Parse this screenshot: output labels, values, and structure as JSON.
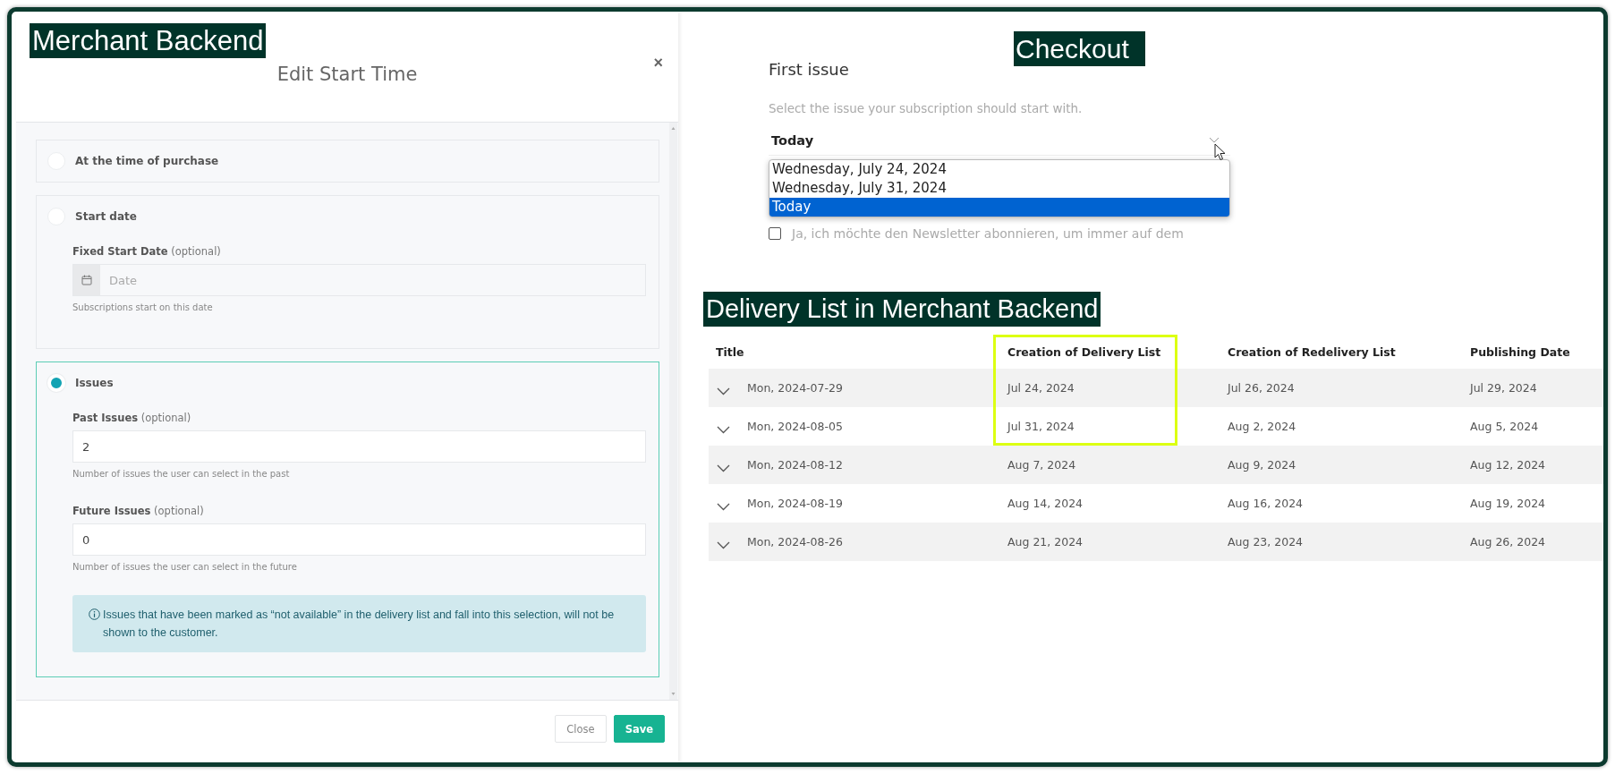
{
  "merchant_backend": {
    "banner": "Merchant Backend",
    "dialog": {
      "title": "Edit Start Time",
      "close": "×",
      "options": [
        {
          "label": "At the time of purchase",
          "selected": false
        },
        {
          "label": "Start date",
          "selected": false,
          "fields": [
            {
              "kind": "date",
              "label": "Fixed Start Date",
              "optional": "(optional)",
              "placeholder": "Date",
              "help": "Subscriptions start on this date"
            }
          ]
        },
        {
          "label": "Issues",
          "selected": true,
          "fields": [
            {
              "kind": "number",
              "label": "Past Issues",
              "optional": "(optional)",
              "value": "2",
              "help": "Number of issues the user can select in the past"
            },
            {
              "kind": "number",
              "label": "Future Issues",
              "optional": "(optional)",
              "value": "0",
              "help": "Number of issues the user can select in the future"
            }
          ],
          "notice": "Issues that have been marked as “not available” in the delivery list and fall into this selection, will not be shown to the customer."
        }
      ],
      "buttons": [
        {
          "label": "Close",
          "kind": "secondary"
        },
        {
          "label": "Save",
          "kind": "primary"
        }
      ]
    }
  },
  "checkout": {
    "banner": "Checkout",
    "heading": "First issue",
    "hint": "Select the issue your subscription should start with.",
    "select": {
      "value": "Today",
      "expanded": true,
      "options": [
        {
          "label": "Wednesday, July 24, 2024",
          "selected": false
        },
        {
          "label": "Wednesday, July 31, 2024",
          "selected": false
        },
        {
          "label": "Today",
          "selected": true
        }
      ]
    },
    "newsletter": {
      "text": "Ja, ich möchte den Newsletter abonnieren, um immer auf dem",
      "checked": false
    }
  },
  "delivery_list": {
    "banner": "Delivery List in Merchant Backend",
    "columns": [
      {
        "label": "Title",
        "highlighted": false
      },
      {
        "label": "Creation of Delivery List",
        "highlighted": true
      },
      {
        "label": "Creation of Redelivery List",
        "highlighted": false
      },
      {
        "label": "Publishing Date",
        "highlighted": false
      }
    ],
    "rows": [
      {
        "expanded": false,
        "highlighted": true,
        "cells": [
          "Mon, 2024-07-29",
          "Jul 24, 2024",
          "Jul 26, 2024",
          "Jul 29, 2024"
        ]
      },
      {
        "expanded": false,
        "highlighted": true,
        "cells": [
          "Mon, 2024-08-05",
          "Jul 31, 2024",
          "Aug 2, 2024",
          "Aug 5, 2024"
        ]
      },
      {
        "expanded": false,
        "highlighted": false,
        "cells": [
          "Mon, 2024-08-12",
          "Aug 7, 2024",
          "Aug 9, 2024",
          "Aug 12, 2024"
        ]
      },
      {
        "expanded": false,
        "highlighted": false,
        "cells": [
          "Mon, 2024-08-19",
          "Aug 14, 2024",
          "Aug 16, 2024",
          "Aug 19, 2024"
        ]
      },
      {
        "expanded": false,
        "highlighted": false,
        "cells": [
          "Mon, 2024-08-26",
          "Aug 21, 2024",
          "Aug 23, 2024",
          "Aug 26, 2024"
        ]
      }
    ]
  }
}
